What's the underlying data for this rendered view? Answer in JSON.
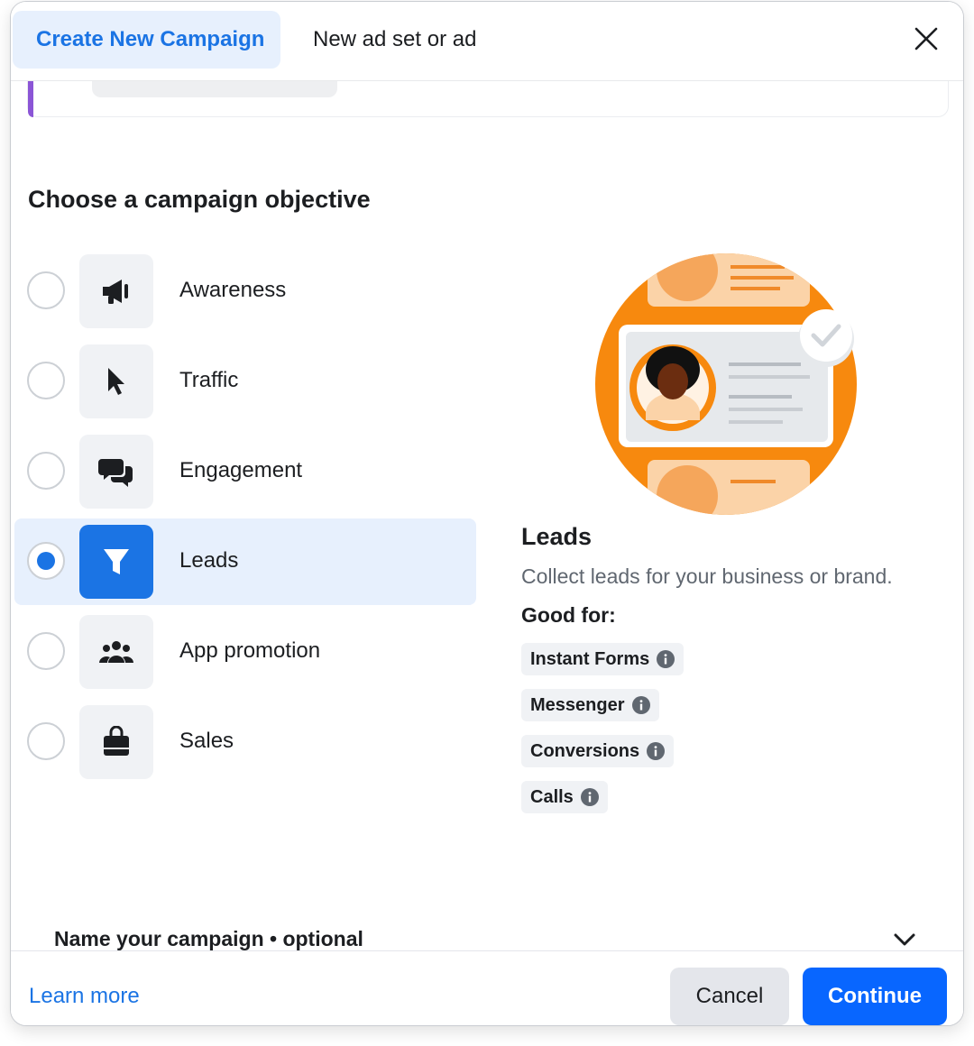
{
  "tabs": {
    "active": "Create New Campaign",
    "other": "New ad set or ad"
  },
  "section_title": "Choose a campaign objective",
  "objectives": [
    {
      "label": "Awareness",
      "icon": "megaphone-icon",
      "selected": false
    },
    {
      "label": "Traffic",
      "icon": "cursor-icon",
      "selected": false
    },
    {
      "label": "Engagement",
      "icon": "chat-bubbles-icon",
      "selected": false
    },
    {
      "label": "Leads",
      "icon": "funnel-icon",
      "selected": true
    },
    {
      "label": "App promotion",
      "icon": "people-icon",
      "selected": false
    },
    {
      "label": "Sales",
      "icon": "shopping-bag-icon",
      "selected": false
    }
  ],
  "detail": {
    "title": "Leads",
    "description": "Collect leads for your business or brand.",
    "good_for_label": "Good for:",
    "chips": [
      "Instant Forms",
      "Messenger",
      "Conversions",
      "Calls"
    ]
  },
  "name_section": "Name your campaign • optional",
  "footer": {
    "learn_more": "Learn more",
    "cancel": "Cancel",
    "continue": "Continue"
  },
  "colors": {
    "accent": "#1b74e4",
    "primary_button": "#0866ff",
    "selected_bg": "#e7f0fd",
    "illustration_orange": "#f7890e"
  }
}
